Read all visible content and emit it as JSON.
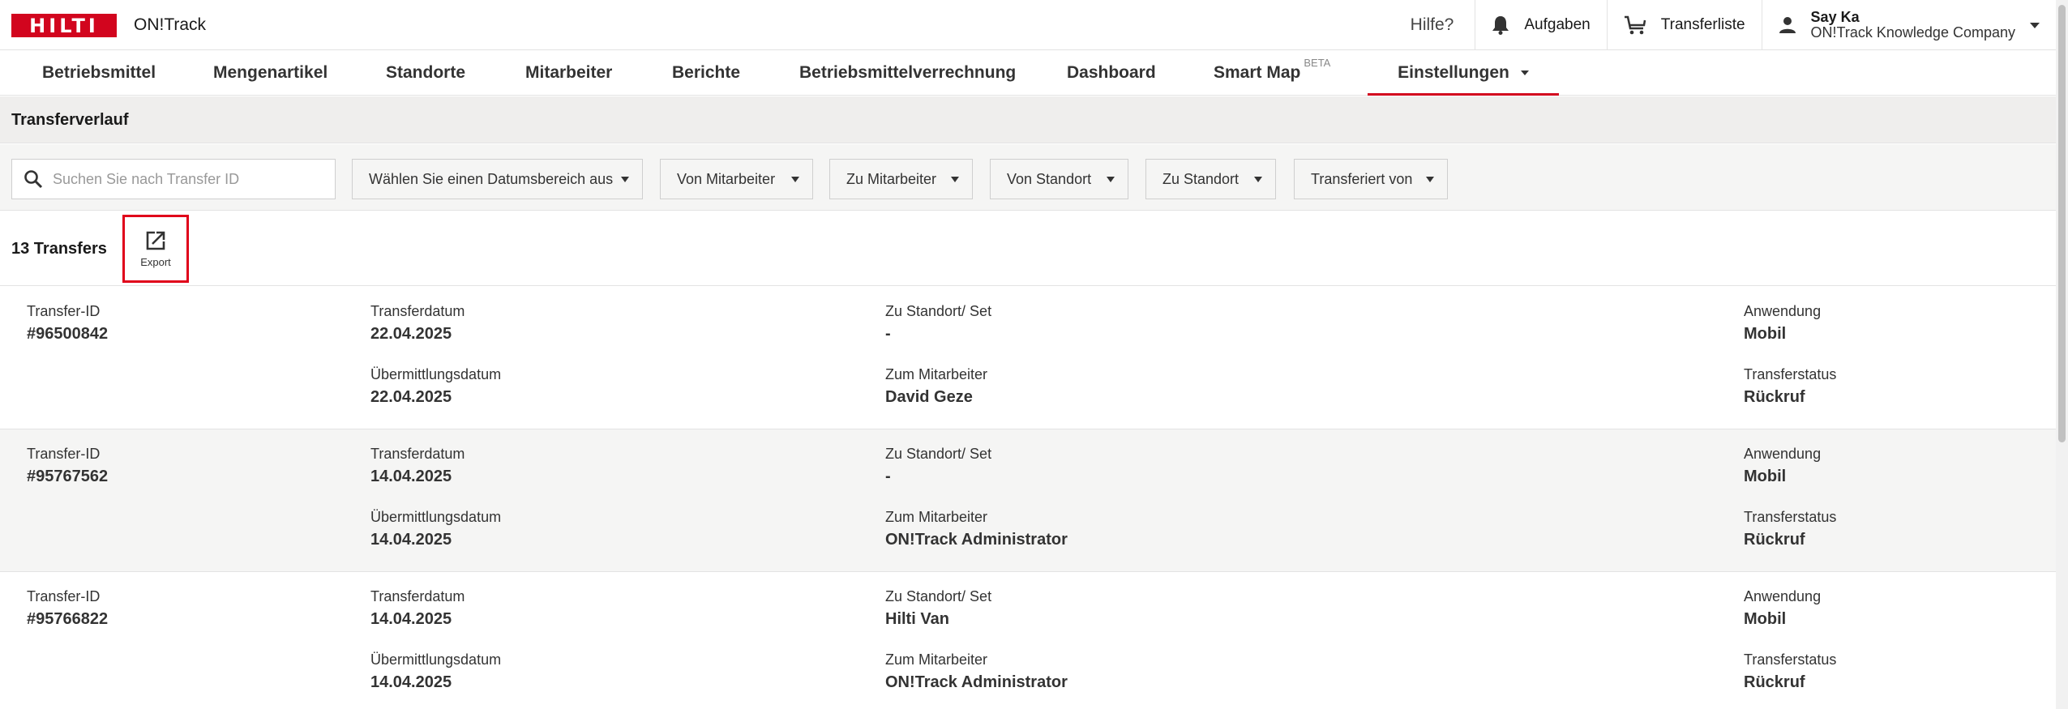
{
  "brand": {
    "logo_text": "HILTI",
    "app_title": "ON!Track",
    "accent": "#d2051e"
  },
  "header": {
    "help_label": "Hilfe?",
    "tasks_label": "Aufgaben",
    "transfer_list_label": "Transferliste",
    "user_name": "Say Ka",
    "user_company": "ON!Track Knowledge Company"
  },
  "nav": {
    "items": [
      {
        "label": "Betriebsmittel"
      },
      {
        "label": "Mengenartikel"
      },
      {
        "label": "Standorte"
      },
      {
        "label": "Mitarbeiter"
      },
      {
        "label": "Berichte"
      },
      {
        "label": "Betriebsmittelverrechnung"
      },
      {
        "label": "Dashboard"
      },
      {
        "label": "Smart Map",
        "badge": "BETA"
      },
      {
        "label": "Einstellungen",
        "active": true
      }
    ]
  },
  "page": {
    "title": "Transferverlauf"
  },
  "filters": {
    "search_placeholder": "Suchen Sie nach Transfer ID",
    "date_range": "Wählen Sie einen Datumsbereich aus",
    "from_employee": "Von Mitarbeiter",
    "to_employee": "Zu Mitarbeiter",
    "from_location": "Von Standort",
    "to_location": "Zu Standort",
    "transferred_by": "Transferiert von"
  },
  "summary": {
    "count_text": "13 Transfers",
    "export_label": "Export"
  },
  "labels": {
    "transfer_id": "Transfer-ID",
    "transfer_date": "Transferdatum",
    "submission_date": "Übermittlungsdatum",
    "to_location": "Zu Standort/ Set",
    "to_employee": "Zum Mitarbeiter",
    "application": "Anwendung",
    "status": "Transferstatus"
  },
  "transfers": [
    {
      "id": "#96500842",
      "transfer_date": "22.04.2025",
      "submission_date": "22.04.2025",
      "to_location": "-",
      "to_employee": "David Geze",
      "application": "Mobil",
      "status": "Rückruf"
    },
    {
      "id": "#95767562",
      "transfer_date": "14.04.2025",
      "submission_date": "14.04.2025",
      "to_location": "-",
      "to_employee": "ON!Track Administrator",
      "application": "Mobil",
      "status": "Rückruf"
    },
    {
      "id": "#95766822",
      "transfer_date": "14.04.2025",
      "submission_date": "14.04.2025",
      "to_location": "Hilti Van",
      "to_employee": "ON!Track Administrator",
      "application": "Mobil",
      "status": "Rückruf"
    }
  ]
}
